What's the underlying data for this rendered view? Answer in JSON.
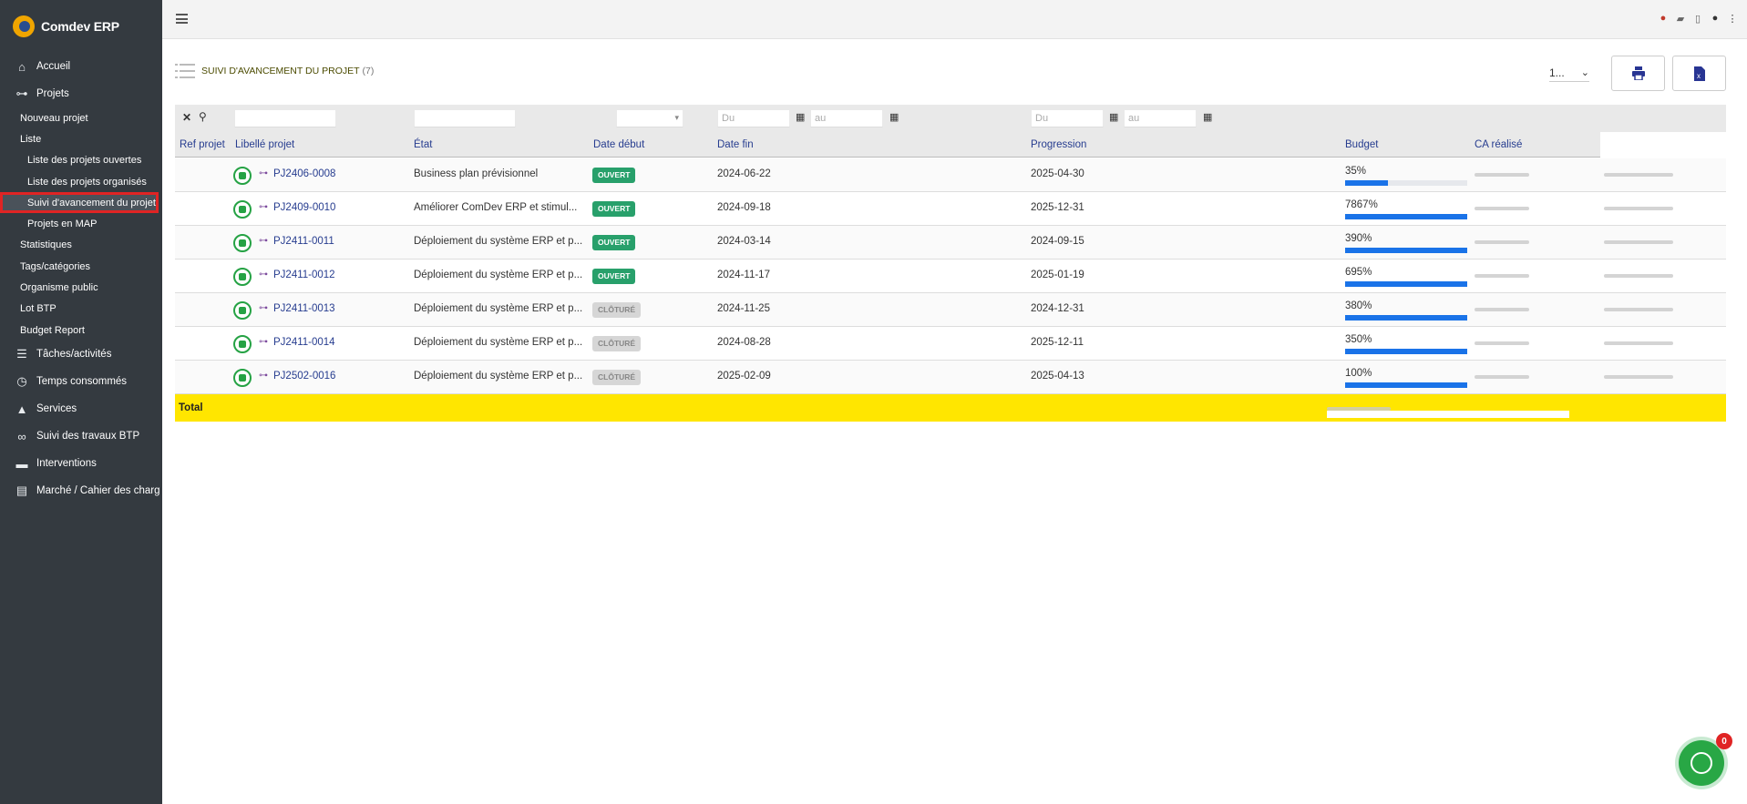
{
  "brand": {
    "name": "Comdev ERP"
  },
  "sidebar": {
    "items": [
      {
        "label": "Accueil",
        "icon": "home-icon"
      },
      {
        "label": "Projets",
        "icon": "sitemap-icon"
      },
      {
        "label": "Nouveau projet"
      },
      {
        "label": "Liste"
      },
      {
        "label": "Liste des projets ouvertes"
      },
      {
        "label": "Liste des projets organisés"
      },
      {
        "label": "Suivi d'avancement du projet",
        "active": true
      },
      {
        "label": "Projets en MAP"
      },
      {
        "label": "Statistiques"
      },
      {
        "label": "Tags/catégories"
      },
      {
        "label": "Organisme public"
      },
      {
        "label": "Lot BTP"
      },
      {
        "label": "Budget Report"
      },
      {
        "label": "Tâches/activités",
        "icon": "tasks-icon"
      },
      {
        "label": "Temps consommés",
        "icon": "clock-icon"
      },
      {
        "label": "Services",
        "icon": "services-icon"
      },
      {
        "label": "Suivi des travaux BTP",
        "icon": "binoculars-icon"
      },
      {
        "label": "Interventions",
        "icon": "truck-icon"
      },
      {
        "label": "Marché / Cahier des charg",
        "icon": "book-icon"
      }
    ]
  },
  "page": {
    "title": "SUIVI D'AVANCEMENT DU PROJET",
    "count": "(7)",
    "per_page": "1..."
  },
  "filters": {
    "du_placeholder": "Du",
    "au_placeholder": "au"
  },
  "table": {
    "headers": [
      "Ref projet",
      "Libellé projet",
      "État",
      "Date début",
      "Date fin",
      "Progression",
      "Budget",
      "CA réalisé"
    ],
    "rows": [
      {
        "ref": "PJ2406-0008",
        "label": "Business plan prévisionnel",
        "status": "OUVERT",
        "status_type": "open",
        "start": "2024-06-22",
        "end": "2025-04-30",
        "progress": "35%",
        "progress_value": 35
      },
      {
        "ref": "PJ2409-0010",
        "label": "Améliorer ComDev ERP et stimul...",
        "status": "OUVERT",
        "status_type": "open",
        "start": "2024-09-18",
        "end": "2025-12-31",
        "progress": "7867%",
        "progress_value": 100
      },
      {
        "ref": "PJ2411-0011",
        "label": "Déploiement du système ERP et p...",
        "status": "OUVERT",
        "status_type": "open",
        "start": "2024-03-14",
        "end": "2024-09-15",
        "progress": "390%",
        "progress_value": 100
      },
      {
        "ref": "PJ2411-0012",
        "label": "Déploiement du système ERP et p...",
        "status": "OUVERT",
        "status_type": "open",
        "start": "2024-11-17",
        "end": "2025-01-19",
        "progress": "695%",
        "progress_value": 100
      },
      {
        "ref": "PJ2411-0013",
        "label": "Déploiement du système ERP et p...",
        "status": "CLÔTURÉ",
        "status_type": "closed",
        "start": "2024-11-25",
        "end": "2024-12-31",
        "progress": "380%",
        "progress_value": 100
      },
      {
        "ref": "PJ2411-0014",
        "label": "Déploiement du système ERP et p...",
        "status": "CLÔTURÉ",
        "status_type": "closed",
        "start": "2024-08-28",
        "end": "2025-12-11",
        "progress": "350%",
        "progress_value": 100
      },
      {
        "ref": "PJ2502-0016",
        "label": "Déploiement du système ERP et p...",
        "status": "CLÔTURÉ",
        "status_type": "closed",
        "start": "2025-02-09",
        "end": "2025-04-13",
        "progress": "100%",
        "progress_value": 100
      }
    ],
    "total_label": "Total"
  },
  "chat": {
    "badge": "0"
  },
  "colors": {
    "sidebar_bg": "#343a40",
    "accent_blue": "#1a73e8",
    "status_open": "#28a06b",
    "total_row": "#ffe600"
  }
}
